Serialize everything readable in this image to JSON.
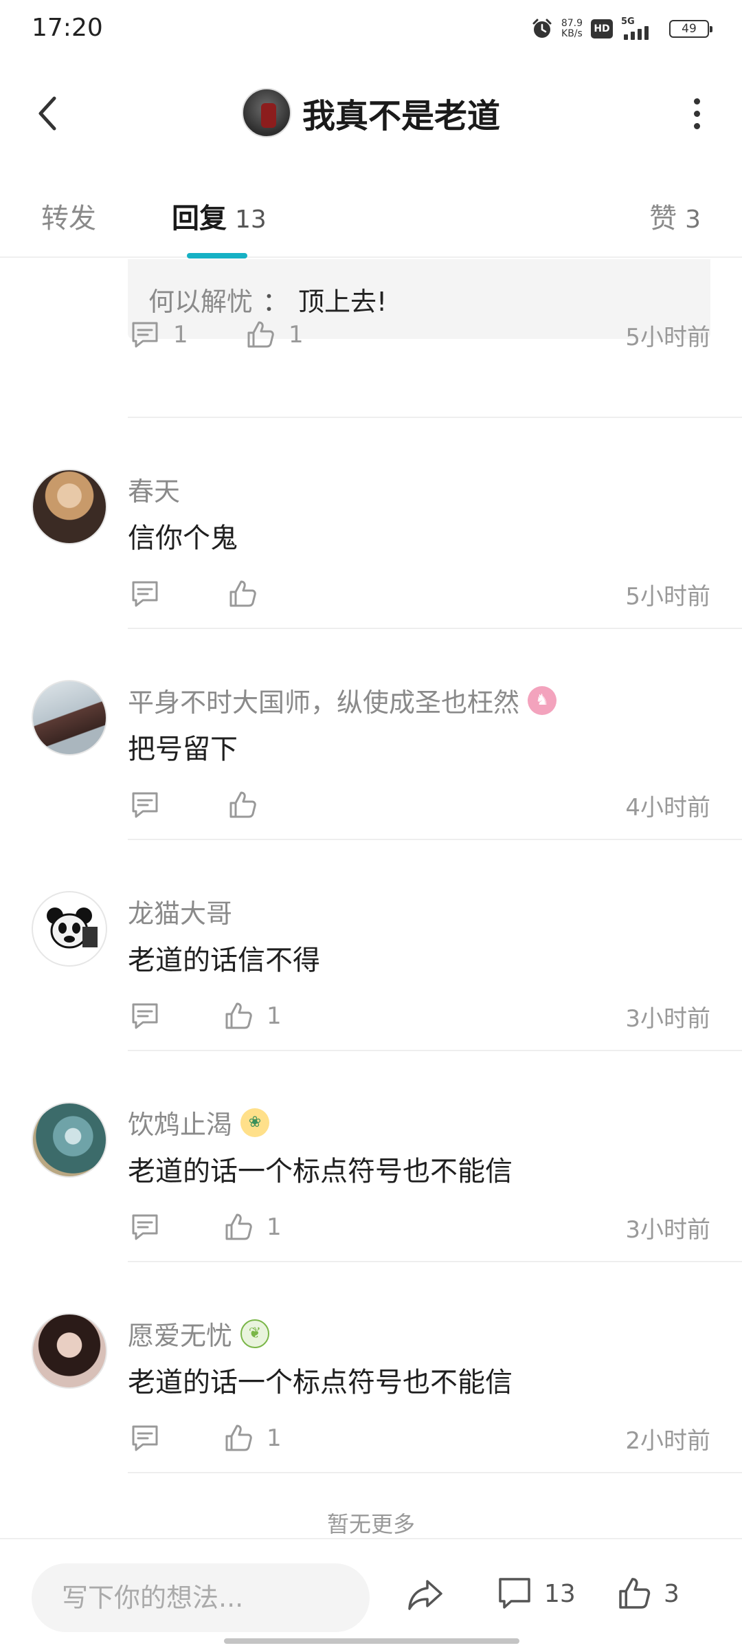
{
  "status_bar": {
    "time": "17:20",
    "net_speed_value": "87.9",
    "net_speed_unit": "KB/s",
    "hd_label": "HD",
    "signal_label": "5G",
    "battery_level": "49"
  },
  "header": {
    "title": "我真不是老道"
  },
  "tabs": [
    {
      "label": "转发",
      "count": ""
    },
    {
      "label": "回复",
      "count": "13",
      "active": true
    },
    {
      "label": "赞",
      "count": "3"
    }
  ],
  "quoted_reply": {
    "user": "何以解忧",
    "separator": "：",
    "text": "顶上去!"
  },
  "top_actions": {
    "comment_count": "1",
    "like_count": "1",
    "time": "5小时前"
  },
  "comments": [
    {
      "username": "春天",
      "text": "信你个鬼",
      "like_count": "",
      "time": "5小时前",
      "badge": "",
      "avatar_colors": [
        "#c89a6a",
        "#3b2b24"
      ]
    },
    {
      "username": "平身不时大国师，纵使成圣也枉然",
      "text": "把号留下",
      "like_count": "",
      "time": "4小时前",
      "badge": "pink-rabbit-badge",
      "avatar_colors": [
        "#c9d3da",
        "#5a3a34"
      ]
    },
    {
      "username": "龙猫大哥",
      "text": "老道的话信不得",
      "like_count": "1",
      "time": "3小时前",
      "badge": "",
      "avatar_colors": [
        "#ffffff",
        "#111111"
      ]
    },
    {
      "username": "饮鸩止渴",
      "text": "老道的话一个标点符号也不能信",
      "like_count": "1",
      "time": "3小时前",
      "badge": "parrot-badge",
      "avatar_colors": [
        "#3c6b6a",
        "#b9a782"
      ]
    },
    {
      "username": "愿爱无忧",
      "text": "老道的话一个标点符号也不能信",
      "like_count": "1",
      "time": "2小时前",
      "badge": "leaf-badge",
      "avatar_colors": [
        "#d8c0b8",
        "#2b1b18"
      ]
    }
  ],
  "no_more_text": "暂无更多",
  "bottom_bar": {
    "input_placeholder": "写下你的想法...",
    "comment_count": "13",
    "like_count": "3"
  },
  "colors": {
    "accent": "#16b1c4",
    "muted_text": "#8a8a8a",
    "badge_pink": "#f3a3bd",
    "badge_green": "#7ab648"
  }
}
